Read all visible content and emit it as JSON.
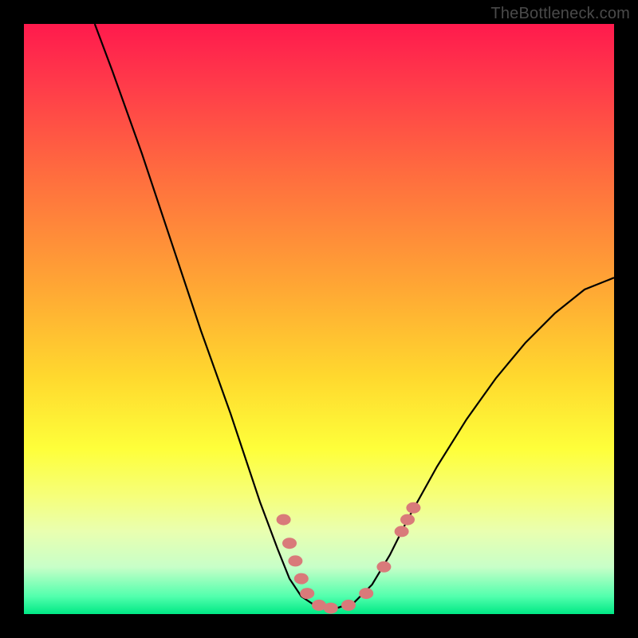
{
  "watermark": "TheBottleneck.com",
  "colors": {
    "frame_bg": "#000000",
    "curve_stroke": "#000000",
    "marker_fill": "#d97a7a",
    "marker_stroke": "#c86a6a"
  },
  "chart_data": {
    "type": "line",
    "title": "",
    "xlabel": "",
    "ylabel": "",
    "xlim": [
      0,
      100
    ],
    "ylim": [
      0,
      100
    ],
    "grid": false,
    "curve": [
      {
        "x": 12,
        "y": 100
      },
      {
        "x": 15,
        "y": 92
      },
      {
        "x": 20,
        "y": 78
      },
      {
        "x": 25,
        "y": 63
      },
      {
        "x": 30,
        "y": 48
      },
      {
        "x": 35,
        "y": 34
      },
      {
        "x": 38,
        "y": 25
      },
      {
        "x": 40,
        "y": 19
      },
      {
        "x": 43,
        "y": 11
      },
      {
        "x": 45,
        "y": 6
      },
      {
        "x": 47,
        "y": 3
      },
      {
        "x": 50,
        "y": 1
      },
      {
        "x": 53,
        "y": 1
      },
      {
        "x": 56,
        "y": 2
      },
      {
        "x": 59,
        "y": 5
      },
      {
        "x": 62,
        "y": 10
      },
      {
        "x": 65,
        "y": 16
      },
      {
        "x": 70,
        "y": 25
      },
      {
        "x": 75,
        "y": 33
      },
      {
        "x": 80,
        "y": 40
      },
      {
        "x": 85,
        "y": 46
      },
      {
        "x": 90,
        "y": 51
      },
      {
        "x": 95,
        "y": 55
      },
      {
        "x": 100,
        "y": 57
      }
    ],
    "markers": [
      {
        "x": 44,
        "y": 16
      },
      {
        "x": 45,
        "y": 12
      },
      {
        "x": 46,
        "y": 9
      },
      {
        "x": 47,
        "y": 6
      },
      {
        "x": 48,
        "y": 3.5
      },
      {
        "x": 50,
        "y": 1.5
      },
      {
        "x": 52,
        "y": 1
      },
      {
        "x": 55,
        "y": 1.5
      },
      {
        "x": 58,
        "y": 3.5
      },
      {
        "x": 61,
        "y": 8
      },
      {
        "x": 64,
        "y": 14
      },
      {
        "x": 65,
        "y": 16
      },
      {
        "x": 66,
        "y": 18
      }
    ]
  }
}
